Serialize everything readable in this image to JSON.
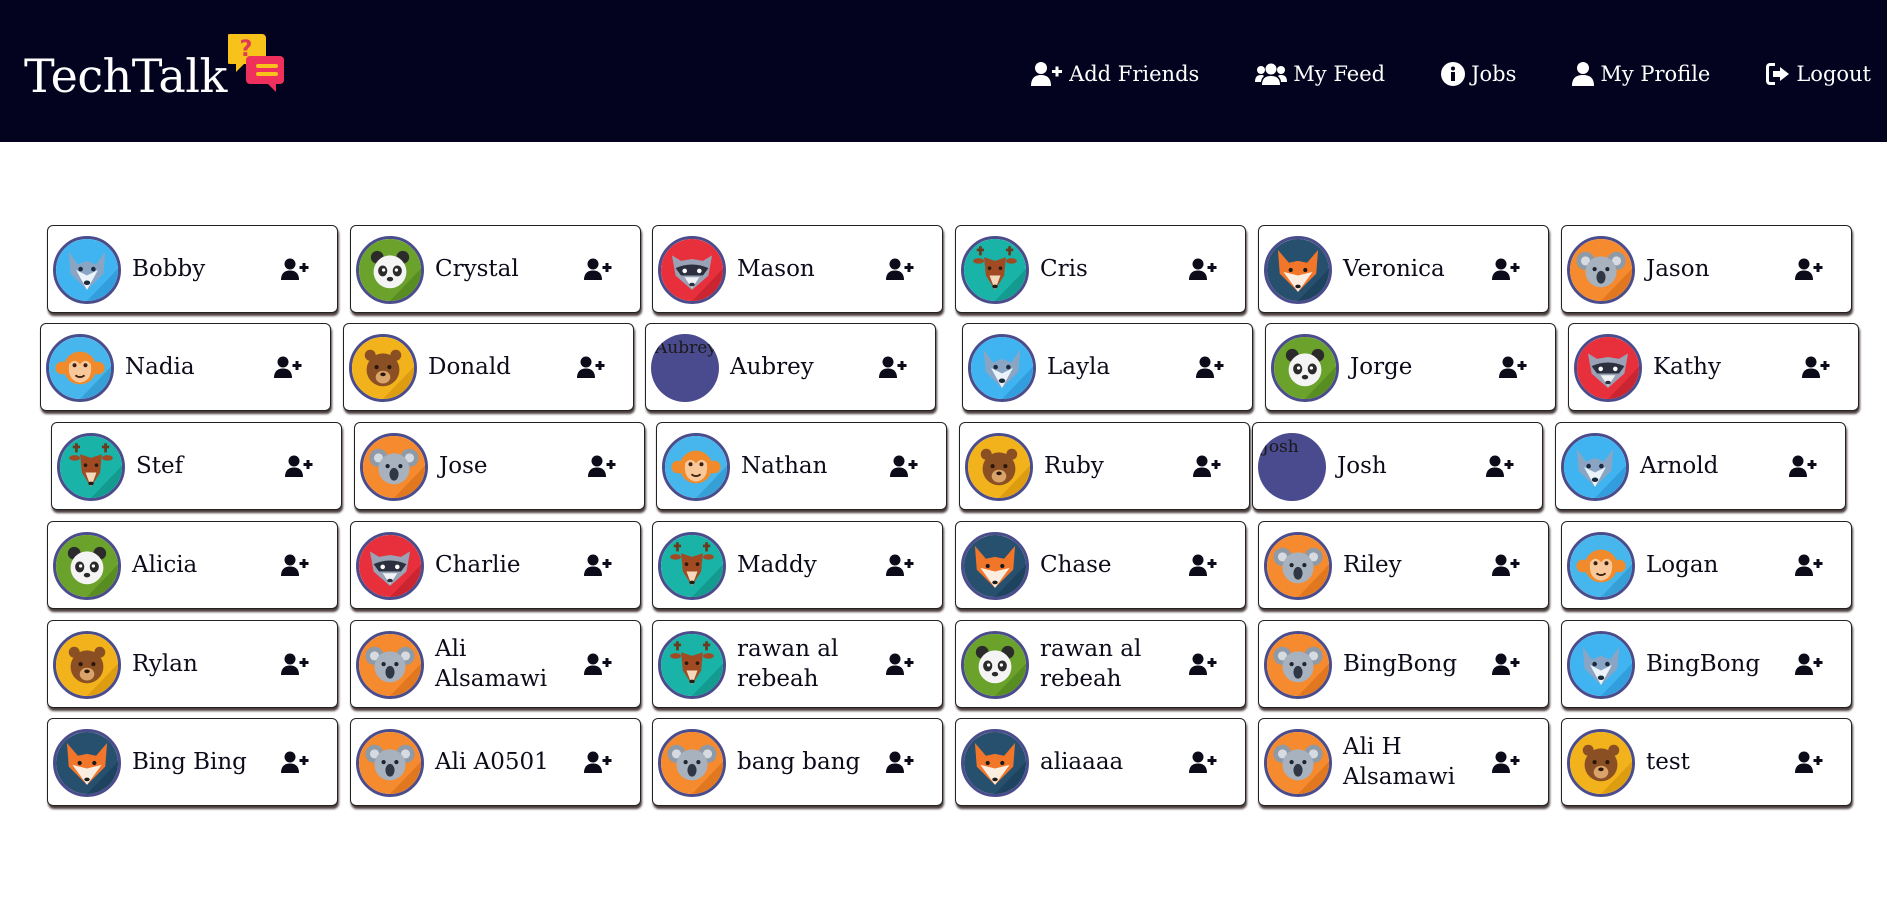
{
  "brand": {
    "name": "TechTalk",
    "icon": "chat-bubbles-icon"
  },
  "nav": [
    {
      "label": "Add Friends",
      "icon": "user-plus-icon"
    },
    {
      "label": "My Feed",
      "icon": "users-icon"
    },
    {
      "label": "Jobs",
      "icon": "info-circle-icon"
    },
    {
      "label": "My Profile",
      "icon": "user-icon"
    },
    {
      "label": "Logout",
      "icon": "sign-out-icon"
    }
  ],
  "add_friend_icon": "user-plus-icon",
  "users": [
    {
      "name": "Bobby",
      "avatar": "wolf"
    },
    {
      "name": "Crystal",
      "avatar": "panda"
    },
    {
      "name": "Mason",
      "avatar": "raccoon"
    },
    {
      "name": "Cris",
      "avatar": "deer"
    },
    {
      "name": "Veronica",
      "avatar": "fox"
    },
    {
      "name": "Jason",
      "avatar": "koala"
    },
    {
      "name": "Nadia",
      "avatar": "monkey"
    },
    {
      "name": "Donald",
      "avatar": "bear"
    },
    {
      "name": "Aubrey",
      "avatar": "broken",
      "alt": "Aubrey"
    },
    {
      "name": "Layla",
      "avatar": "wolf"
    },
    {
      "name": "Jorge",
      "avatar": "panda"
    },
    {
      "name": "Kathy",
      "avatar": "raccoon"
    },
    {
      "name": "Stef",
      "avatar": "deer"
    },
    {
      "name": "Jose",
      "avatar": "koala"
    },
    {
      "name": "Nathan",
      "avatar": "monkey"
    },
    {
      "name": "Ruby",
      "avatar": "bear"
    },
    {
      "name": "Josh",
      "avatar": "broken",
      "alt": "Josh"
    },
    {
      "name": "Arnold",
      "avatar": "wolf"
    },
    {
      "name": "Alicia",
      "avatar": "panda"
    },
    {
      "name": "Charlie",
      "avatar": "raccoon"
    },
    {
      "name": "Maddy",
      "avatar": "deer"
    },
    {
      "name": "Chase",
      "avatar": "fox"
    },
    {
      "name": "Riley",
      "avatar": "koala"
    },
    {
      "name": "Logan",
      "avatar": "monkey"
    },
    {
      "name": "Rylan",
      "avatar": "bear"
    },
    {
      "name": "Ali Alsamawi",
      "avatar": "koala"
    },
    {
      "name": "rawan al rebeah",
      "avatar": "deer"
    },
    {
      "name": "rawan al rebeah",
      "avatar": "panda"
    },
    {
      "name": "BingBong",
      "avatar": "koala"
    },
    {
      "name": "BingBong",
      "avatar": "wolf"
    },
    {
      "name": "Bing Bing",
      "avatar": "fox"
    },
    {
      "name": "Ali A0501",
      "avatar": "koala"
    },
    {
      "name": "bang bang",
      "avatar": "koala"
    },
    {
      "name": "aliaaaa",
      "avatar": "fox"
    },
    {
      "name": "Ali H Alsamawi",
      "avatar": "koala"
    },
    {
      "name": "test",
      "avatar": "bear"
    }
  ],
  "colors": {
    "header_bg": "#03031f",
    "avatar_border": "#4a4c8c",
    "wolf_bg": "#3fb4f0",
    "panda_bg": "#6aa22c",
    "raccoon_bg": "#e8303c",
    "deer_bg": "#19b3a8",
    "fox_bg": "#27506e",
    "koala_bg": "#f58a2e",
    "monkey_bg": "#46b6ec",
    "bear_bg": "#f2b21c"
  }
}
